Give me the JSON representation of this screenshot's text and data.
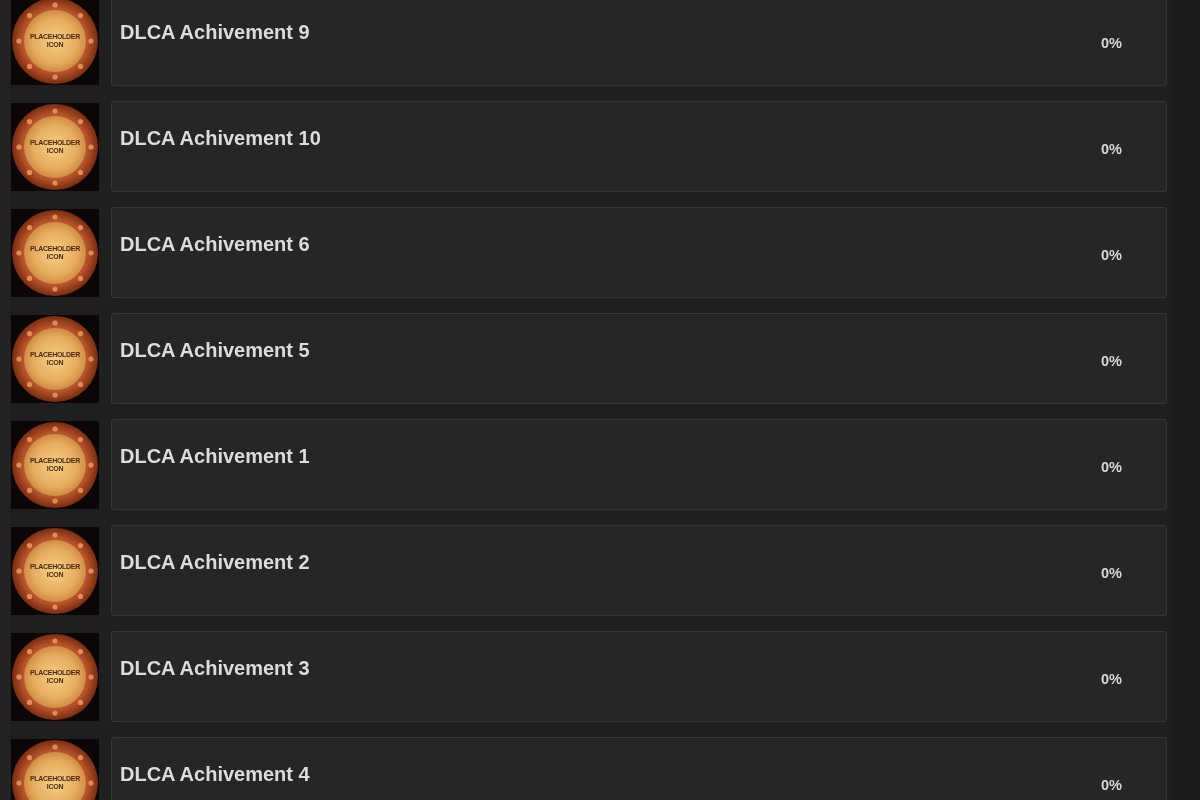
{
  "achievements": [
    {
      "title": "DLCA Achivement 9",
      "icon_text": "PLACEHOLDER ICON",
      "progress": "0%"
    },
    {
      "title": "DLCA Achivement 10",
      "icon_text": "PLACEHOLDER ICON",
      "progress": "0%"
    },
    {
      "title": "DLCA Achivement 6",
      "icon_text": "PLACEHOLDER ICON",
      "progress": "0%"
    },
    {
      "title": "DLCA Achivement 5",
      "icon_text": "PLACEHOLDER ICON",
      "progress": "0%"
    },
    {
      "title": "DLCA Achivement 1",
      "icon_text": "PLACEHOLDER ICON",
      "progress": "0%"
    },
    {
      "title": "DLCA Achivement 2",
      "icon_text": "PLACEHOLDER ICON",
      "progress": "0%"
    },
    {
      "title": "DLCA Achivement 3",
      "icon_text": "PLACEHOLDER ICON",
      "progress": "0%"
    },
    {
      "title": "DLCA Achivement 4",
      "icon_text": "PLACEHOLDER ICON",
      "progress": "0%"
    }
  ]
}
